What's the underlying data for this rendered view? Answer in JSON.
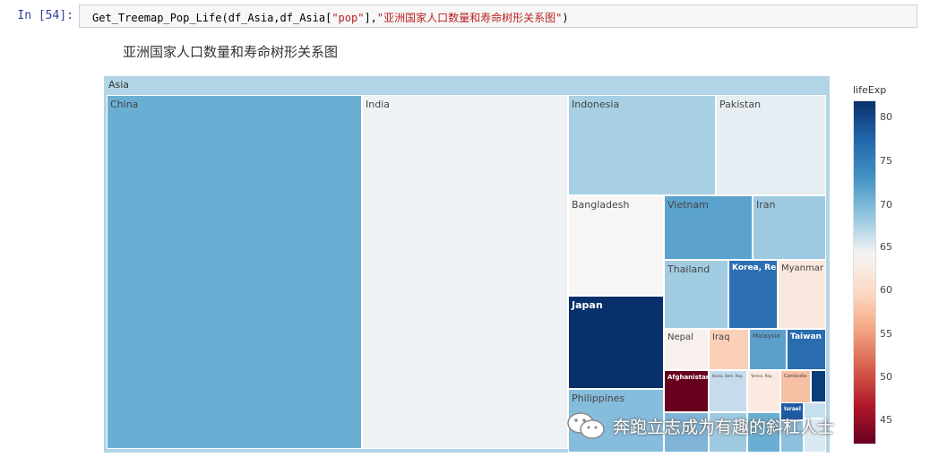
{
  "cell": {
    "prompt": "In [54]:",
    "code_pre": "Get_Treemap_Pop_Life(df_Asia,df_Asia[",
    "code_str1": "\"pop\"",
    "code_mid": "],",
    "code_str2": "\"亚洲国家人口数量和寿命树形关系图\"",
    "code_end": ")"
  },
  "figure": {
    "title": "亚洲国家人口数量和寿命树形关系图",
    "root_label": "Asia",
    "colorbar_title": "lifeExp",
    "colorbar_ticks": [
      "80",
      "75",
      "70",
      "65",
      "60",
      "55",
      "50",
      "45"
    ],
    "colorbar_colors": [
      "#08306b",
      "#2166ac",
      "#4393c3",
      "#92c5de",
      "#f4f4f4",
      "#fddbc7",
      "#f4a582",
      "#d6604d",
      "#b2182b",
      "#67001f"
    ]
  },
  "chart_data": {
    "type": "treemap",
    "root": "Asia",
    "color_variable": "lifeExp",
    "colorbar_range": [
      45,
      82
    ],
    "tiles": [
      {
        "label": "China",
        "color": "#6aafd3"
      },
      {
        "label": "India",
        "color": "#eef2f5"
      },
      {
        "label": "Indonesia",
        "color": "#a7d0e4"
      },
      {
        "label": "Pakistan",
        "color": "#e6eef3"
      },
      {
        "label": "Bangladesh",
        "color": "#f7f6f4"
      },
      {
        "label": "Vietnam",
        "color": "#5ba3ce"
      },
      {
        "label": "Iran",
        "color": "#9ecae1"
      },
      {
        "label": "Thailand",
        "color": "#a2cce2"
      },
      {
        "label": "Korea, Rep.",
        "color": "#2c6fb3"
      },
      {
        "label": "Myanmar",
        "color": "#fae7dd"
      },
      {
        "label": "Japan",
        "color": "#08306b"
      },
      {
        "label": "Nepal",
        "color": "#f8f0ec"
      },
      {
        "label": "Iraq",
        "color": "#fbd0b9"
      },
      {
        "label": "Malaysia",
        "color": "#5c9fcb"
      },
      {
        "label": "Taiwan",
        "color": "#2a6cb0"
      },
      {
        "label": "Afghanistan",
        "color": "#67001f"
      },
      {
        "label": "Korea, Dem. Rep.",
        "color": "#c6dced"
      },
      {
        "label": "Yemen, Rep.",
        "color": "#faeae2"
      },
      {
        "label": "Cambodia",
        "color": "#f6c0a5"
      },
      {
        "label": "Philippines",
        "color": "#86bcdc"
      },
      {
        "label": "Israel",
        "color": "#1d5aa3"
      }
    ]
  },
  "watermark": {
    "text": "奔跑立志成为有趣的斜杠人士"
  }
}
